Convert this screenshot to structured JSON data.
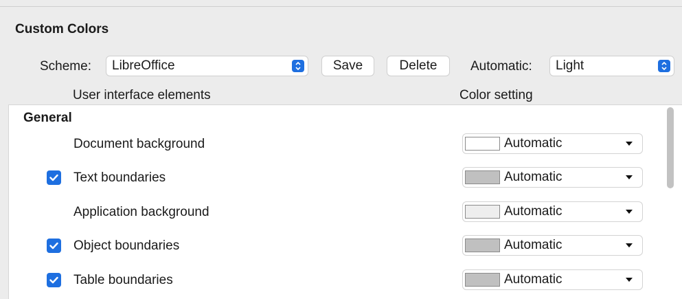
{
  "section_title": "Custom Colors",
  "scheme": {
    "label": "Scheme:",
    "value": "LibreOffice",
    "save_label": "Save",
    "delete_label": "Delete"
  },
  "automatic": {
    "label": "Automatic:",
    "value": "Light"
  },
  "columns": {
    "elements": "User interface elements",
    "setting": "Color setting"
  },
  "group": "General",
  "items": [
    {
      "label": "Document background",
      "checkbox": false,
      "color_value": "Automatic",
      "swatch": "#ffffff"
    },
    {
      "label": "Text boundaries",
      "checkbox": true,
      "color_value": "Automatic",
      "swatch": "#c0c0c0"
    },
    {
      "label": "Application background",
      "checkbox": false,
      "color_value": "Automatic",
      "swatch": "#eeeeee"
    },
    {
      "label": "Object boundaries",
      "checkbox": true,
      "color_value": "Automatic",
      "swatch": "#c0c0c0"
    },
    {
      "label": "Table boundaries",
      "checkbox": true,
      "color_value": "Automatic",
      "swatch": "#c0c0c0"
    }
  ],
  "colors": {
    "accent": "#1e6fe0",
    "window_bg": "#ececec",
    "list_bg": "#ffffff"
  }
}
